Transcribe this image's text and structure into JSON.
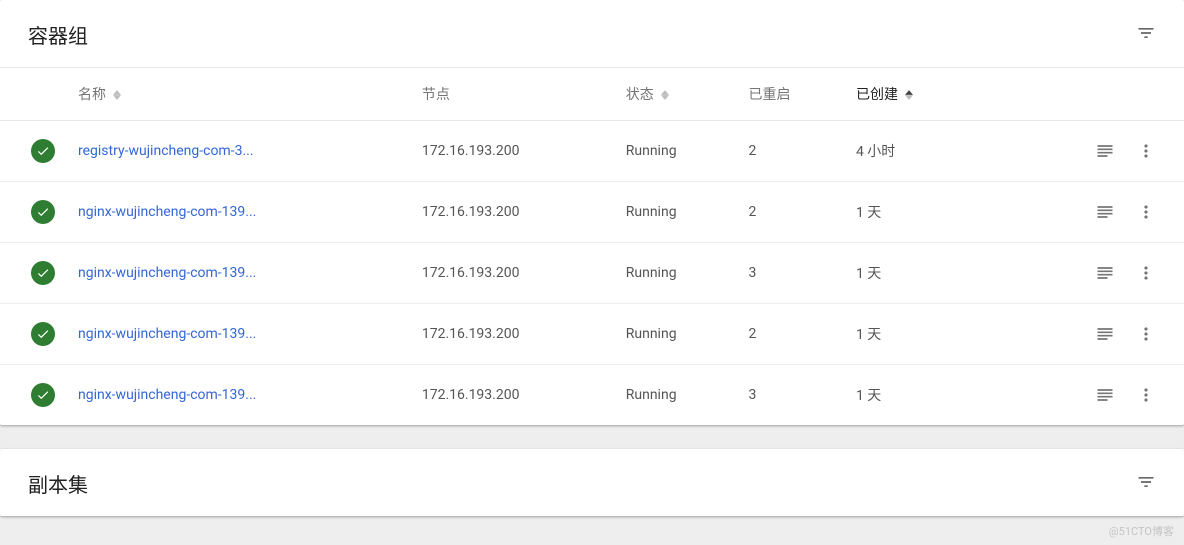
{
  "card1": {
    "title": "容器组",
    "headers": {
      "name": "名称",
      "node": "节点",
      "status": "状态",
      "restarted": "已重启",
      "created": "已创建"
    },
    "rows": [
      {
        "name": "registry-wujincheng-com-3...",
        "node": "172.16.193.200",
        "status": "Running",
        "restarted": "2",
        "created": "4 小时"
      },
      {
        "name": "nginx-wujincheng-com-139...",
        "node": "172.16.193.200",
        "status": "Running",
        "restarted": "2",
        "created": "1 天"
      },
      {
        "name": "nginx-wujincheng-com-139...",
        "node": "172.16.193.200",
        "status": "Running",
        "restarted": "3",
        "created": "1 天"
      },
      {
        "name": "nginx-wujincheng-com-139...",
        "node": "172.16.193.200",
        "status": "Running",
        "restarted": "2",
        "created": "1 天"
      },
      {
        "name": "nginx-wujincheng-com-139...",
        "node": "172.16.193.200",
        "status": "Running",
        "restarted": "3",
        "created": "1 天"
      }
    ]
  },
  "card2": {
    "title": "副本集"
  },
  "watermark": "@51CTO博客"
}
